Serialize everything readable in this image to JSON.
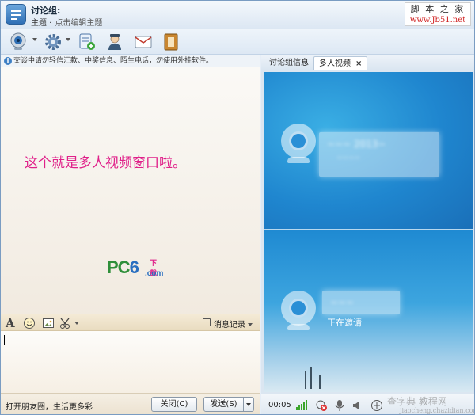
{
  "titlebar": {
    "group_name": "讨论组:",
    "subject_label": "主题 ·",
    "subject_hint": "点击编辑主题",
    "watermark_line1": "脚 本 之 家",
    "watermark_line2": "www.Jb51.net"
  },
  "toolbar": {
    "items": [
      "webcam-icon",
      "gear-icon",
      "add-doc-icon",
      "agent-icon",
      "mail-icon",
      "book-icon"
    ]
  },
  "notice": {
    "icon": "i",
    "text": "交谈中请勿轻信汇款、中奖信息、陌生电话，勿使用外挂软件。"
  },
  "chat": {
    "caption": "这个就是多人视频窗口啦。",
    "logo": {
      "pc": "PC",
      "six": "6",
      "com": ".com",
      "dl": "下载"
    }
  },
  "input_toolbar": {
    "font_icon_glyph": "A",
    "history_label": "消息记录"
  },
  "bottom": {
    "promo": "打开朋友圈，生活更多彩",
    "close_label": "关闭(C)",
    "send_label": "发送(S)"
  },
  "tabs": [
    {
      "label": "讨论组信息",
      "active": false
    },
    {
      "label": "多人视频",
      "active": true,
      "close": "×"
    }
  ],
  "video": {
    "slot1_text": "~~~ 2013~",
    "slot1_sub": "~~~~",
    "slot2_name": "~~~",
    "inviting": "正在邀请"
  },
  "controls": {
    "time": "00:05",
    "site_mark": "查字典 教程网",
    "site_url": "jiaocheng.chazidian.com"
  },
  "colors": {
    "accent_pink": "#e0218a",
    "logo_green": "#2f8f3a",
    "logo_blue": "#2a6fc0",
    "video_blue": "#1f86cf"
  }
}
